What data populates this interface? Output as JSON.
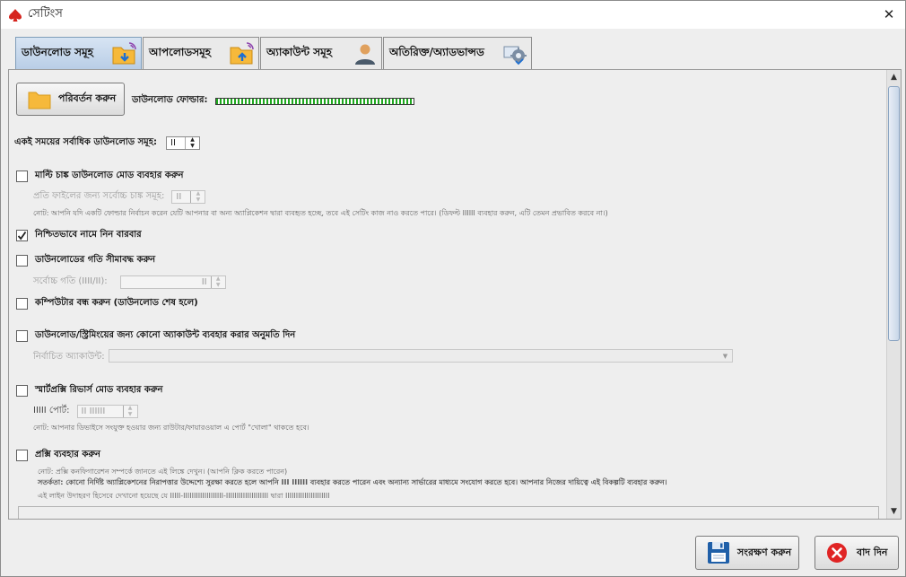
{
  "window": {
    "title": "সেটিংস",
    "close_glyph": "✕"
  },
  "tabs": [
    {
      "label": "ডাউনলোড সমূহ",
      "icon": "download-folder-icon",
      "active": true
    },
    {
      "label": "আপলোডসমূহ",
      "icon": "upload-folder-icon",
      "active": false
    },
    {
      "label": "অ্যাকাউন্ট সমূহ",
      "icon": "user-icon",
      "active": false
    },
    {
      "label": "অতিরিক্ত/অ্যাডভান্সড",
      "icon": "gear-monitor-icon",
      "active": false
    }
  ],
  "download": {
    "change_button": "পরিবর্তন করুন",
    "folder_label": "ডাউনলোড ফোল্ডার:",
    "folder_progress": 1.0,
    "concurrent_label": "একই সময়ের সর্বাধিক ডাউনলোড সমূহ:",
    "concurrent_value": "II"
  },
  "options": {
    "multi_chunk": {
      "label": "মাল্টি চাঙ্ক ডাউনলোড মোড ব্যবহার করুন",
      "checked": false,
      "sub_label": "প্রতি ফাইলের জন্য সর্বোচ্চ চাঙ্ক সমূহ:",
      "sub_value": "II",
      "note": "নোট: আপনি যদি একটি ফোল্ডার নির্বাচন করেন যেটি আপনার বা অন্য অ্যাপ্লিকেশন দ্বারা ব্যবহৃত হচ্ছে, তবে এই সেটিং কাজ নাও করতে পারে। (ডিফল্ট IIIIII ব্যবহার করুন, এটি তেমন প্রভাবিত করবে না।)"
    },
    "auto_select": {
      "label": "নিশ্চিতভাবে নামে নিন বারবার",
      "checked": true
    },
    "limit_speed": {
      "label": "ডাউনলোডের গতি সীমাবদ্ধ করুন",
      "checked": false,
      "sub_label": "সর্বোচ্চ গতি (IIII/II):",
      "sub_value": "II"
    },
    "power_off": {
      "label": "কম্পিউটার বন্ধ করুন (ডাউনলোড শেষ হলে)",
      "checked": false
    },
    "use_account": {
      "label": "ডাউনলোড/স্ট্রিমিংয়ের জন্য কোনো অ্যাকাউন্ট ব্যবহার করার অনুমতি দিন",
      "checked": false,
      "sub_label": "নির্বাচিত অ্যাকাউন্ট:"
    },
    "smart_proxy": {
      "label": "স্মার্টপ্রক্সি রিভার্স মোড ব্যবহার করুন",
      "checked": false,
      "sub_label": "IIIII পোর্ট:",
      "sub_value": "II IIIIII",
      "note": "নোট: আপনার ডিভাইসে সংযুক্ত হওয়ার জন্য রাউটার/ফায়ারওয়াল এ পোর্ট \"খোলা\" থাকতে হবে।"
    },
    "proxy": {
      "label": "প্রক্সি ব্যবহার করুন",
      "checked": false,
      "note1": "নোট: প্রক্সি কনফিগারেশন সম্পর্কে জানতে এই লিঙ্কে দেখুন। (আপনি ক্লিক করতে পারেন)",
      "note2": "সতর্কতা: কোনো নির্দিষ্ট অ্যাপ্লিকেশনের নিরাপত্তার উদ্দেশ্যে সুরক্ষা করতে হলে আপনি III IIIIII ব্যবহার করতে পারেন এবং অন্যান্য সার্ভারের মাধ্যমে সংযোগ করতে হবে। আপনার নিজের দায়িত্বে এই বিকল্পটি ব্যবহার করুন।",
      "note3": "এই লাইন উদাহরণ হিসেবে দেখানো হয়েছে যে IIIII-IIIIIIIIIIIIIIIIIII-IIIIIIIIIIIIIIIIIIII দ্বারা IIIIIIIIIIIIIIIIIIIII"
    }
  },
  "footer": {
    "save_button": "সংরক্ষণ করুন",
    "cancel_button": "বাদ দিন"
  }
}
